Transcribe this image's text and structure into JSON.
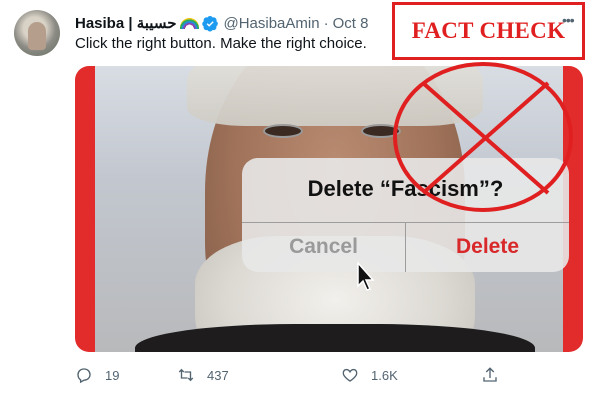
{
  "tweet": {
    "author": {
      "display_name": "Hasiba | حسيبة",
      "handle": "@HasibaAmin",
      "separator": "·",
      "date": "Oct 8",
      "avatar_icon": "user-avatar",
      "badge_icon": "verified-badge-icon",
      "emoji_icon": "rainbow-icon"
    },
    "text": "Click the right button. Make the right choice.",
    "more_icon": "more-dots-icon",
    "more_label": "•••",
    "overlay": {
      "label": "FACT CHECK",
      "accent_color": "#e02020"
    },
    "media": {
      "dialog": {
        "title": "Delete “Fascism”?",
        "cancel_label": "Cancel",
        "delete_label": "Delete",
        "delete_color": "#d8282a"
      }
    },
    "actions": {
      "reply_count": "19",
      "retweet_count": "437",
      "like_count": "1.6K",
      "share_icon": "share-icon"
    }
  }
}
